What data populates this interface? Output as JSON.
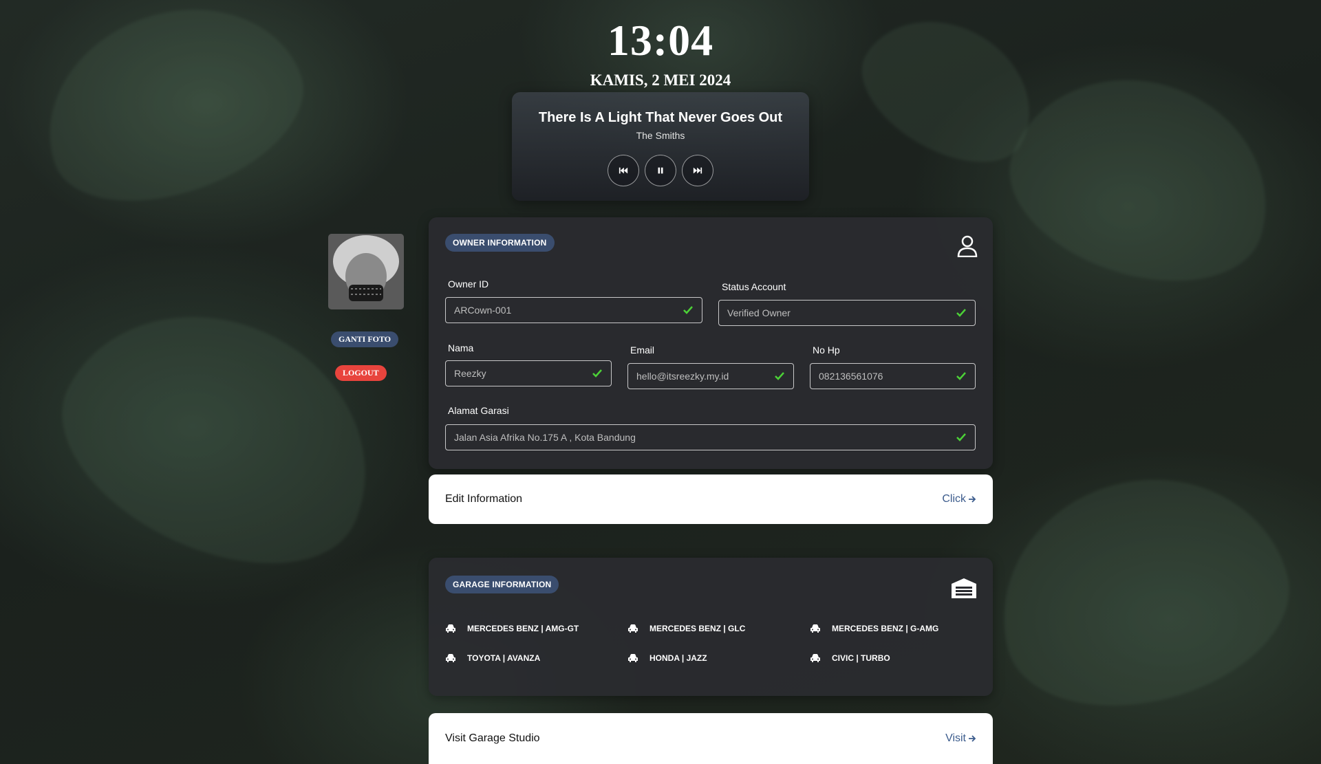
{
  "clock": {
    "time": "13:04",
    "date": "KAMIS, 2 MEI 2024"
  },
  "player": {
    "title": "There Is A Light That Never Goes Out",
    "artist": "The Smiths"
  },
  "profile": {
    "change_photo_label": "GANTI FOTO",
    "logout_label": "LOGOUT"
  },
  "owner": {
    "badge": "OWNER INFORMATION",
    "owner_id_label": "Owner ID",
    "owner_id_value": "ARCown-001",
    "status_label": "Status Account",
    "status_value": "Verified Owner",
    "nama_label": "Nama",
    "nama_value": "Reezky",
    "email_label": "Email",
    "email_value": "hello@itsreezky.my.id",
    "hp_label": "No Hp",
    "hp_value": "082136561076",
    "alamat_label": "Alamat Garasi",
    "alamat_value": "Jalan Asia Afrika No.175 A , Kota Bandung"
  },
  "edit": {
    "label": "Edit Information",
    "link": "Click"
  },
  "garage": {
    "badge": "GARAGE INFORMATION",
    "cars": [
      "MERCEDES BENZ | AMG-GT",
      "MERCEDES BENZ | GLC",
      "MERCEDES BENZ | G-AMG",
      "TOYOTA | AVANZA",
      "HONDA | JAZZ",
      "CIVIC | TURBO"
    ]
  },
  "visit": {
    "label": "Visit Garage Studio",
    "link": "Visit"
  },
  "colors": {
    "accent_badge": "#3a4d6e",
    "logout": "#e8443d",
    "check": "#4cd137",
    "link": "#3b5b8c"
  },
  "icons": {
    "owner": "user-icon",
    "garage": "warehouse-icon",
    "car": "car-icon",
    "check": "check-icon"
  }
}
